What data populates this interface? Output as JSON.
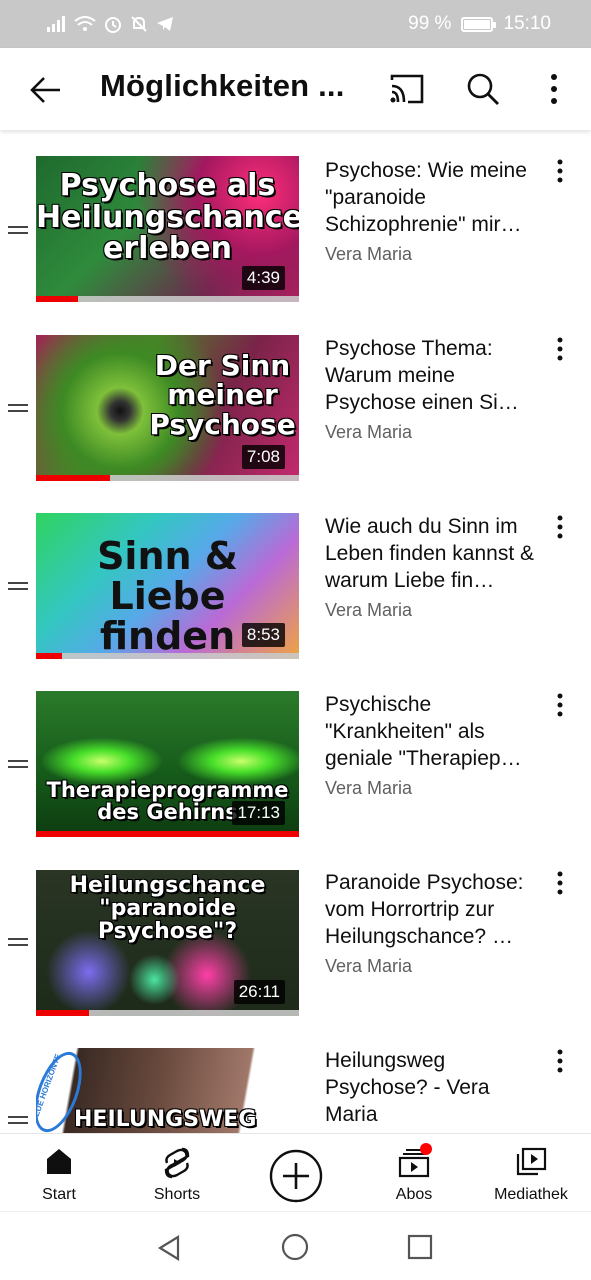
{
  "status_bar": {
    "battery": "99 %",
    "time": "15:10"
  },
  "header": {
    "title": "Möglichkeiten ..."
  },
  "videos": [
    {
      "title": "Psychose: Wie meine \"paranoide Schizophrenie\" mir…",
      "channel": "Vera Maria",
      "duration": "4:39",
      "thumb_text": "Psychose als Heilungschance erleben",
      "progress": 0.16
    },
    {
      "title": "Psychose Thema: Warum meine Psychose einen Si…",
      "channel": "Vera Maria",
      "duration": "7:08",
      "thumb_text": "Der Sinn meiner Psychose",
      "progress": 0.28
    },
    {
      "title": "Wie auch du Sinn im Leben finden kannst & warum Liebe fin…",
      "channel": "Vera Maria",
      "duration": "8:53",
      "thumb_text": "Sinn & Liebe finden",
      "progress": 0.1
    },
    {
      "title": "Psychische \"Krankheiten\" als geniale \"Therapiep…",
      "channel": "Vera Maria",
      "duration": "17:13",
      "thumb_text": "Therapieprogramme des Gehirns",
      "progress": 1.0
    },
    {
      "title": "Paranoide Psychose: vom Horrortrip zur Heilungschance? …",
      "channel": "Vera Maria",
      "duration": "26:11",
      "thumb_text": "Heilungschance \"paranoide Psychose\"?",
      "progress": 0.2
    },
    {
      "title": "Heilungsweg Psychose? - Vera Maria",
      "channel": "",
      "duration": "",
      "thumb_text": "HEILUNGSWEG",
      "badge": "NEUE HORIZONTE",
      "progress": 0
    }
  ],
  "bottom_nav": {
    "start": "Start",
    "shorts": "Shorts",
    "abos": "Abos",
    "mediathek": "Mediathek"
  },
  "colors": {
    "accent_red": "#ff0000",
    "progress_red": "#e00000"
  }
}
